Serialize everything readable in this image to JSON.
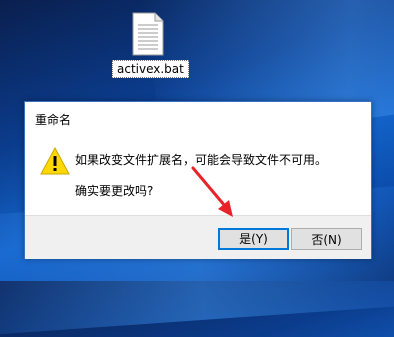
{
  "desktop": {
    "file_label": "activex.bat",
    "file_icon": "text-file-icon"
  },
  "dialog": {
    "title": "重命名",
    "icon": "warning-icon",
    "message": "如果改变文件扩展名，可能会导致文件不可用。",
    "question": "确实要更改吗?",
    "yes_label": "是(Y)",
    "no_label": "否(N)"
  },
  "annotation": {
    "arrow_color": "#e8232a"
  }
}
